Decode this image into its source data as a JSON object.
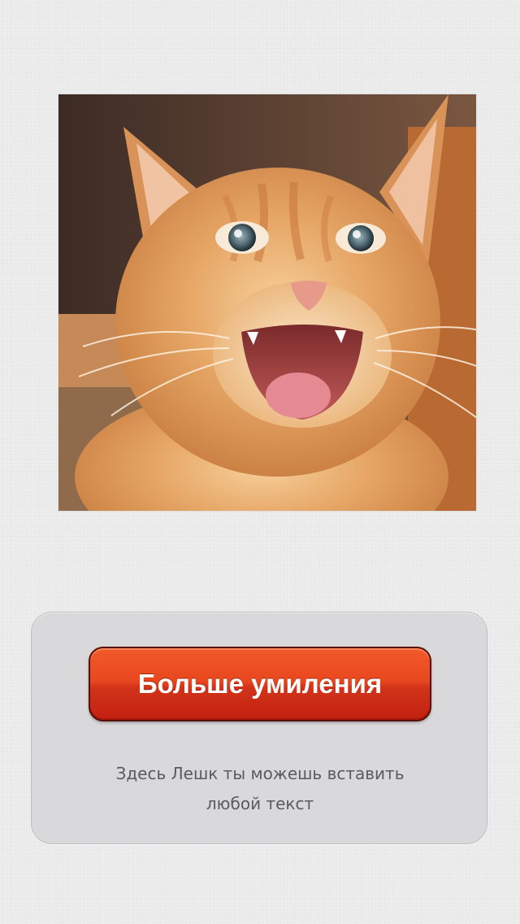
{
  "photo": {
    "alt": "kitten-photo",
    "subject": "ginger kitten with open mouth"
  },
  "panel": {
    "button_label": "Больше умиления",
    "caption_line1": "Здесь Лешк ты можешь вставить",
    "caption_line2": "любой текст"
  },
  "colors": {
    "background": "#e9e9ea",
    "panel": "#d9d9db",
    "button_top": "#f05a2b",
    "button_bottom": "#c1200f",
    "button_border": "#5a0f08",
    "caption_text": "#5b5b5d"
  }
}
